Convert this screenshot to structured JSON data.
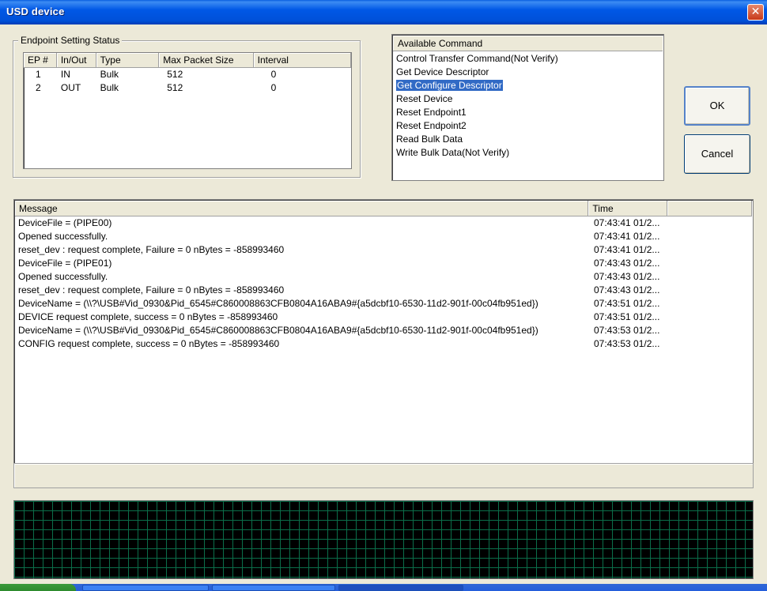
{
  "window": {
    "title": "USD device",
    "close_glyph": "✕"
  },
  "endpoint_group": {
    "label": "Endpoint Setting Status",
    "columns": [
      "EP #",
      "In/Out",
      "Type",
      "Max Packet Size",
      "Interval"
    ],
    "rows": [
      [
        "1",
        "IN",
        "Bulk",
        "512",
        "0"
      ],
      [
        "2",
        "OUT",
        "Bulk",
        "512",
        "0"
      ]
    ]
  },
  "commands": {
    "header": "Available Command",
    "items": [
      "Control Transfer Command(Not Verify)",
      "Get Device Descriptor",
      "Get Configure Descriptor",
      "Reset Device",
      "Reset Endpoint1",
      "Reset Endpoint2",
      "Read Bulk Data",
      "Write Bulk Data(Not Verify)"
    ],
    "selected": "Get Configure Descriptor"
  },
  "buttons": {
    "ok": "OK",
    "cancel": "Cancel"
  },
  "messages": {
    "columns": [
      "Message",
      "Time",
      ""
    ],
    "rows": [
      [
        "DeviceFile = (PIPE00)",
        "07:43:41 01/2..."
      ],
      [
        "Opened successfully.",
        "07:43:41 01/2..."
      ],
      [
        "reset_dev : request complete, Failure = 0 nBytes = -858993460",
        "07:43:41 01/2..."
      ],
      [
        "DeviceFile = (PIPE01)",
        "07:43:43 01/2..."
      ],
      [
        "Opened successfully.",
        "07:43:43 01/2..."
      ],
      [
        "reset_dev : request complete, Failure = 0 nBytes = -858993460",
        "07:43:43 01/2..."
      ],
      [
        "DeviceName = (\\\\?\\USB#Vid_0930&Pid_6545#C860008863CFB0804A16ABA9#{a5dcbf10-6530-11d2-901f-00c04fb951ed})",
        "07:43:51 01/2..."
      ],
      [
        "DEVICE request complete, success = 0 nBytes = -858993460",
        "07:43:51 01/2..."
      ],
      [
        "DeviceName = (\\\\?\\USB#Vid_0930&Pid_6545#C860008863CFB0804A16ABA9#{a5dcbf10-6530-11d2-901f-00c04fb951ed})",
        "07:43:53 01/2..."
      ],
      [
        "CONFIG request complete, success = 0 nBytes = -858993460",
        "07:43:53 01/2..."
      ]
    ]
  },
  "colors": {
    "selection": "#316ac5",
    "titlebar": "#0058e6",
    "graph_grid": "#0b6e4a"
  }
}
